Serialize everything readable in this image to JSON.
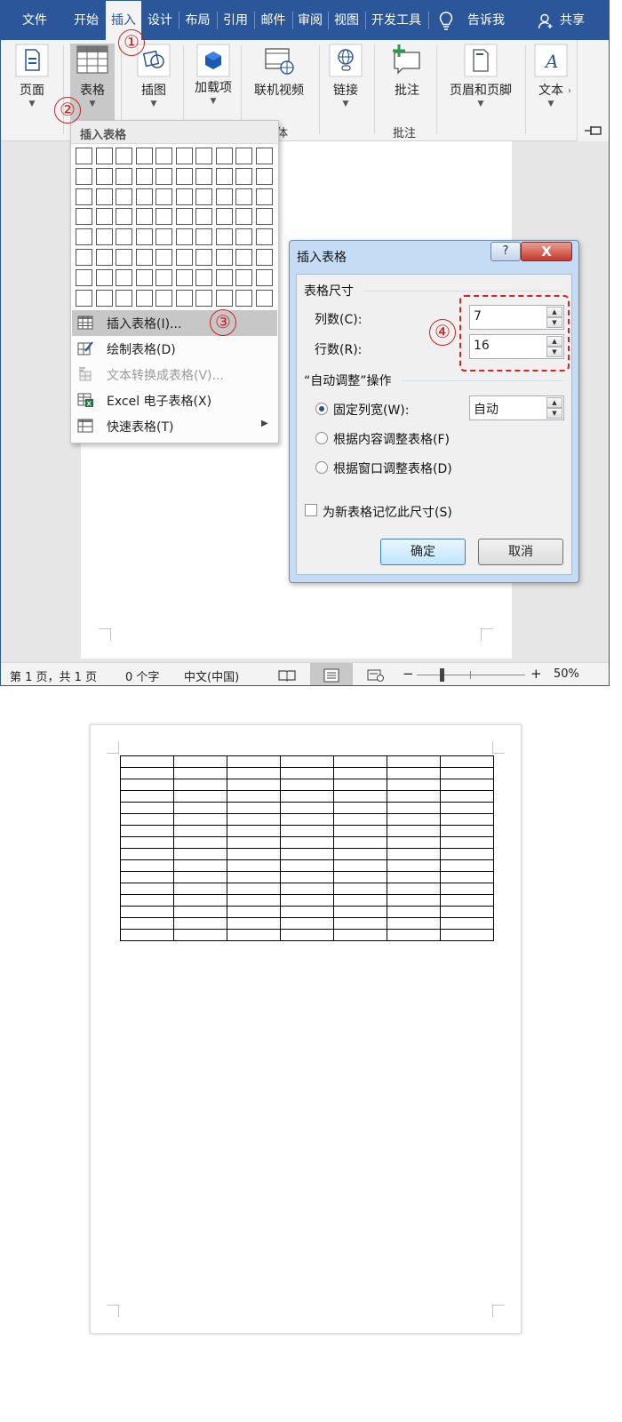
{
  "menu_tabs": [
    "文件",
    "开始",
    "插入",
    "设计",
    "布局",
    "引用",
    "邮件",
    "审阅",
    "视图",
    "开发工具"
  ],
  "active_tab": "插入",
  "tell_me": "告诉我",
  "share": "共享",
  "ribbon": {
    "page": "页面",
    "table": "表格",
    "illustrations": "插图",
    "addins": "加载项",
    "online_video": "联机视频",
    "media_group": "体",
    "links": "链接",
    "comment": "批注",
    "comment_group": "批注",
    "header_footer": "页眉和页脚",
    "text": "文本"
  },
  "table_menu": {
    "header": "插入表格",
    "grid_cols": 10,
    "grid_rows": 8,
    "items": [
      {
        "label": "插入表格(I)...",
        "state": "highlighted"
      },
      {
        "label": "绘制表格(D)",
        "state": "normal"
      },
      {
        "label": "文本转换成表格(V)...",
        "state": "disabled"
      },
      {
        "label": "Excel 电子表格(X)",
        "state": "normal"
      },
      {
        "label": "快速表格(T)",
        "state": "normal",
        "submenu": true
      }
    ]
  },
  "dialog": {
    "title": "插入表格",
    "help": "?",
    "close": "X",
    "size_section": "表格尺寸",
    "cols_label": "列数(C):",
    "cols_value": "7",
    "rows_label": "行数(R):",
    "rows_value": "16",
    "autofit_section": "“自动调整”操作",
    "options": [
      {
        "label": "固定列宽(W):",
        "selected": true
      },
      {
        "label": "根据内容调整表格(F)",
        "selected": false
      },
      {
        "label": "根据窗口调整表格(D)",
        "selected": false
      }
    ],
    "fixed_width_value": "自动",
    "remember_label": "为新表格记忆此尺寸(S)",
    "remember_checked": false,
    "ok": "确定",
    "cancel": "取消"
  },
  "steps": [
    "①",
    "②",
    "③",
    "④"
  ],
  "status": {
    "page": "第 1 页，共 1 页",
    "words": "0 个字",
    "lang": "中文(中国)",
    "zoom_minus": "−",
    "zoom_plus": "+",
    "zoom": "50%"
  },
  "result_table": {
    "cols": 7,
    "rows": 16
  },
  "colors": {
    "accent": "#2b579a",
    "annotation": "#d02020"
  }
}
